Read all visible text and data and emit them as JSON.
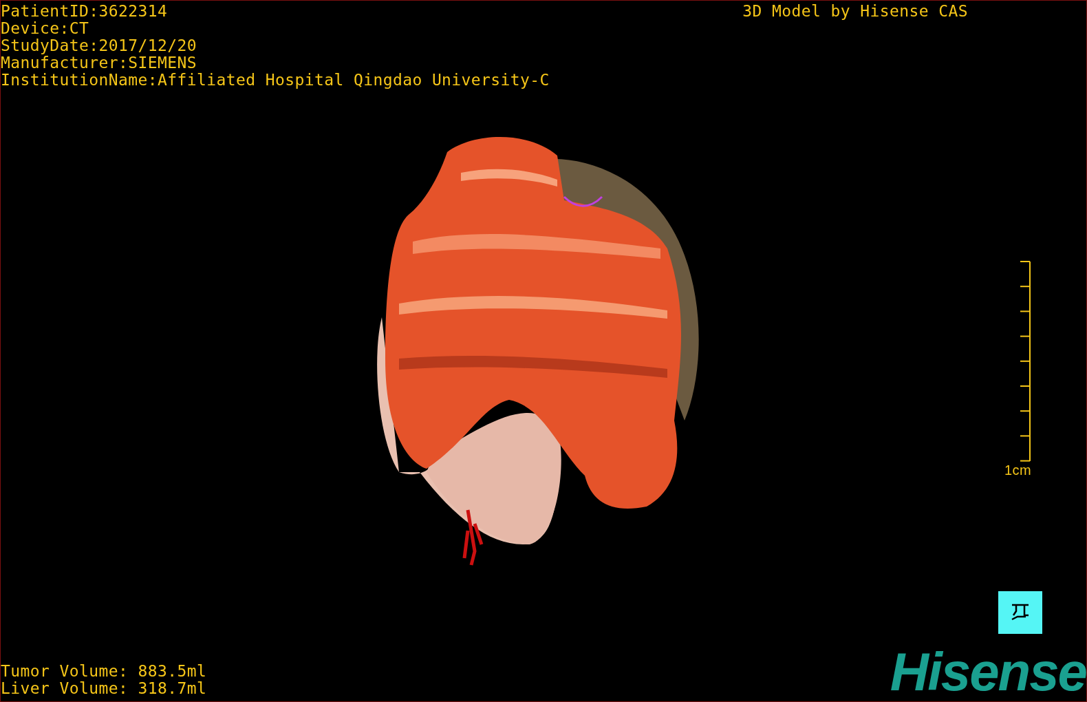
{
  "study_info": [
    "PatientID:3622314",
    "Device:CT",
    "StudyDate:2017/12/20",
    "Manufacturer:SIEMENS",
    "InstitutionName:Affiliated Hospital Qingdao University-C"
  ],
  "title": "3D Model by Hisense CAS",
  "scale_bar": {
    "label": "1cm"
  },
  "volumes": [
    "Tumor Volume: 883.5ml",
    "Liver Volume: 318.7ml"
  ],
  "logo": "Hisense"
}
